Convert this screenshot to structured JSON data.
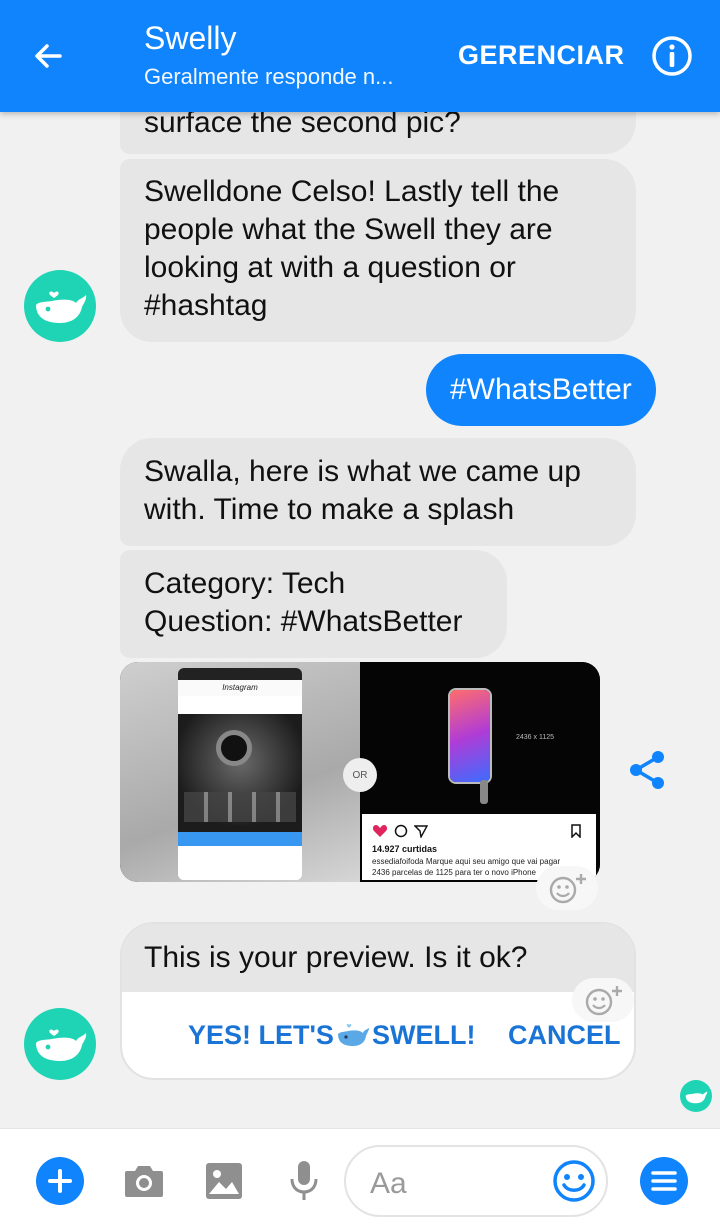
{
  "header": {
    "title": "Swelly",
    "subtitle": "Geralmente responde n...",
    "manage_label": "GERENCIAR"
  },
  "messages": {
    "partial": "surface the second pic?",
    "swelldone_lines": [
      "Swelldone Celso! Lastly tell the",
      "people what the Swell they are",
      "looking at with a question or",
      "#hashtag"
    ],
    "user_reply": "#WhatsBetter",
    "swalla_lines": [
      "Swalla, here is what we came up",
      "with. Time to make a splash"
    ],
    "category_lines": [
      "Category: Tech",
      "Question: #WhatsBetter"
    ]
  },
  "photo": {
    "or_label": "OR",
    "ig_logo": "Instagram",
    "likes": "14.927 curtidas",
    "caption_line1": "essediafoifoda Marque aqui seu amigo que vai pagar",
    "caption_line2": "2436 parcelas de 1125 para ter o novo iPhone",
    "resolution": "2436 x 1125"
  },
  "preview": {
    "question": "This is your preview. Is it ok?",
    "yes_before": "YES! LET'S",
    "yes_after": "SWELL!",
    "cancel": "CANCEL"
  },
  "composer": {
    "placeholder": "Aa"
  },
  "colors": {
    "accent": "#0f84fd",
    "bubble_in": "#e6e6e6",
    "avatar": "#1ed4b4"
  },
  "icons": [
    "back-arrow-icon",
    "info-icon",
    "share-icon",
    "add-reaction-icon",
    "whale-icon",
    "plus-icon",
    "camera-icon",
    "image-icon",
    "microphone-icon",
    "emoji-icon",
    "menu-icon"
  ]
}
